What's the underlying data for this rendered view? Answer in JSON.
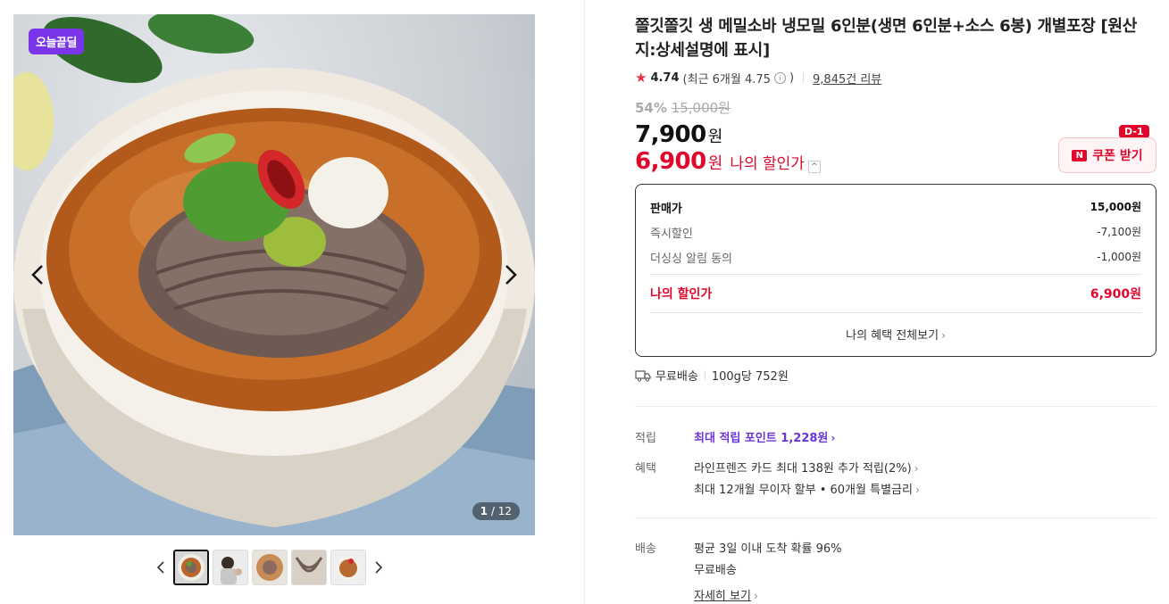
{
  "gallery": {
    "badge": "오늘끝딜",
    "counter_current": "1",
    "counter_total": "/ 12",
    "thumbnail_count": 5
  },
  "product": {
    "title": "쫄깃쫄깃 생 메밀소바 냉모밀 6인분(생면 6인분+소스 6봉) 개별포장 [원산지:상세설명에 표시]",
    "rating": "4.74",
    "recent_rating": "(최근 6개월 4.75",
    "recent_rating_close": ")",
    "reviews": "9,845건 리뷰",
    "discount_pct": "54%",
    "original_price": "15,000원",
    "price": "7,900",
    "price_unit": "원",
    "my_price": "6,900",
    "my_price_unit": "원",
    "my_price_label": "나의 할인가"
  },
  "coupon": {
    "label": "쿠폰 받기",
    "badge": "D-1",
    "logo": "N"
  },
  "breakdown": {
    "rows": [
      {
        "label": "판매가",
        "value": "15,000원"
      },
      {
        "label": "즉시할인",
        "value": "-7,100원"
      },
      {
        "label": "더싱싱 알림 동의",
        "value": "-1,000원"
      }
    ],
    "total_label": "나의 할인가",
    "total_value": "6,900원",
    "more": "나의 혜택 전체보기"
  },
  "shipping_summary": {
    "free": "무료배송",
    "unit_price": "100g당 752원"
  },
  "points": {
    "label": "적립",
    "value": "최대 적립 포인트 1,228원"
  },
  "benefits": {
    "label": "혜택",
    "items": [
      "라인프렌즈 카드 최대 138원 추가 적립(2%)",
      "최대 12개월 무이자 할부 • 60개월 특별금리"
    ]
  },
  "delivery": {
    "label": "배송",
    "arrival": "평균 3일 이내 도착 확률 96%",
    "fee": "무료배송",
    "more": "자세히 보기"
  },
  "colors": {
    "accent_red": "#e0072c",
    "purple": "#6a35d8",
    "deal_badge": "#7a35e8"
  }
}
